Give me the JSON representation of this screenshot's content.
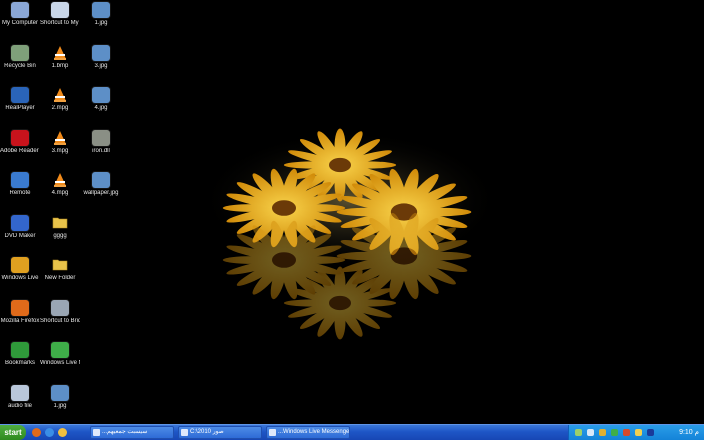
{
  "desktop": {
    "icons": [
      {
        "label": "My Computer",
        "icon": "computer-icon",
        "color": "#8aa7d6"
      },
      {
        "label": "Shortcut to My Documents",
        "icon": "documents-icon",
        "color": "#c9d6e8"
      },
      {
        "label": "1.jpg",
        "icon": "image-file-icon",
        "color": "#5d8fc7"
      },
      {
        "label": "Recycle Bin",
        "icon": "recycle-bin-icon",
        "color": "#7fa07a"
      },
      {
        "label": "1.bmp",
        "icon": "vlc-icon",
        "color": "#f08a1a"
      },
      {
        "label": "3.jpg",
        "icon": "image-file-icon",
        "color": "#5d8fc7"
      },
      {
        "label": "RealPlayer",
        "icon": "realplayer-icon",
        "color": "#2a64b8"
      },
      {
        "label": "2.mpg",
        "icon": "vlc-icon",
        "color": "#f08a1a"
      },
      {
        "label": "4.jpg",
        "icon": "image-file-icon",
        "color": "#5d8fc7"
      },
      {
        "label": "Adobe Reader 9",
        "icon": "adobe-reader-icon",
        "color": "#c8131c"
      },
      {
        "label": "3.mpg",
        "icon": "vlc-icon",
        "color": "#f08a1a"
      },
      {
        "label": "iron.dll",
        "icon": "dll-file-icon",
        "color": "#8a8f85"
      },
      {
        "label": "Remote",
        "icon": "remote-icon",
        "color": "#3a7bd0"
      },
      {
        "label": "4.mpg",
        "icon": "vlc-icon",
        "color": "#f08a1a"
      },
      {
        "label": "wallpaper.jpg",
        "icon": "image-file-icon",
        "color": "#5d8fc7"
      },
      {
        "label": "DVD Maker",
        "icon": "dvd-maker-icon",
        "color": "#3366cc"
      },
      {
        "label": "gggg",
        "icon": "folder-icon",
        "color": "#e8c34a"
      },
      {
        "label": "Windows Live",
        "icon": "windows-live-icon",
        "color": "#e0a020"
      },
      {
        "label": "New Folder",
        "icon": "folder-icon",
        "color": "#e8c34a"
      },
      {
        "label": "Mozilla Firefox",
        "icon": "firefox-icon",
        "color": "#e06a1a"
      },
      {
        "label": "Shortcut to Bridge",
        "icon": "shortcut-icon",
        "color": "#9aa6b4"
      },
      {
        "label": "Bookmarks",
        "icon": "bookmarks-icon",
        "color": "#2f9a3a"
      },
      {
        "label": "Windows Live Messenger",
        "icon": "messenger-icon",
        "color": "#3fae49"
      },
      {
        "label": "audio file",
        "icon": "audio-file-icon",
        "color": "#b9c7da"
      },
      {
        "label": "1.jpg",
        "icon": "image-file-icon",
        "color": "#5d8fc7"
      }
    ]
  },
  "taskbar": {
    "start_label": "start",
    "quick_launch": [
      {
        "icon": "firefox-icon",
        "color": "#e06a1a"
      },
      {
        "icon": "internet-explorer-icon",
        "color": "#3a8ee6"
      },
      {
        "icon": "outlook-icon",
        "color": "#f0c040"
      }
    ],
    "windows": [
      {
        "label": "...سيسبت جمعيهم",
        "icon": "window-icon"
      },
      {
        "label": "C:\\2010 صور",
        "icon": "folder-window-icon"
      },
      {
        "label": "...Windows Live Messenger",
        "icon": "window-icon"
      }
    ],
    "tray": {
      "icons": [
        {
          "icon": "network-icon",
          "color": "#9ad06a"
        },
        {
          "icon": "volume-icon",
          "color": "#d8e8f8"
        },
        {
          "icon": "shield-icon",
          "color": "#e0b030"
        },
        {
          "icon": "messenger-icon",
          "color": "#3fae49"
        },
        {
          "icon": "security-icon",
          "color": "#d84a2a"
        },
        {
          "icon": "update-icon",
          "color": "#f0d050"
        },
        {
          "icon": "language-icon",
          "color": "#1a3a9a"
        }
      ],
      "clock": "9:10 م"
    }
  },
  "colors": {
    "petal": "#f6c21a",
    "center": "#6b3a08",
    "taskbar": "#1e56c6",
    "start": "#3c9b2c"
  }
}
